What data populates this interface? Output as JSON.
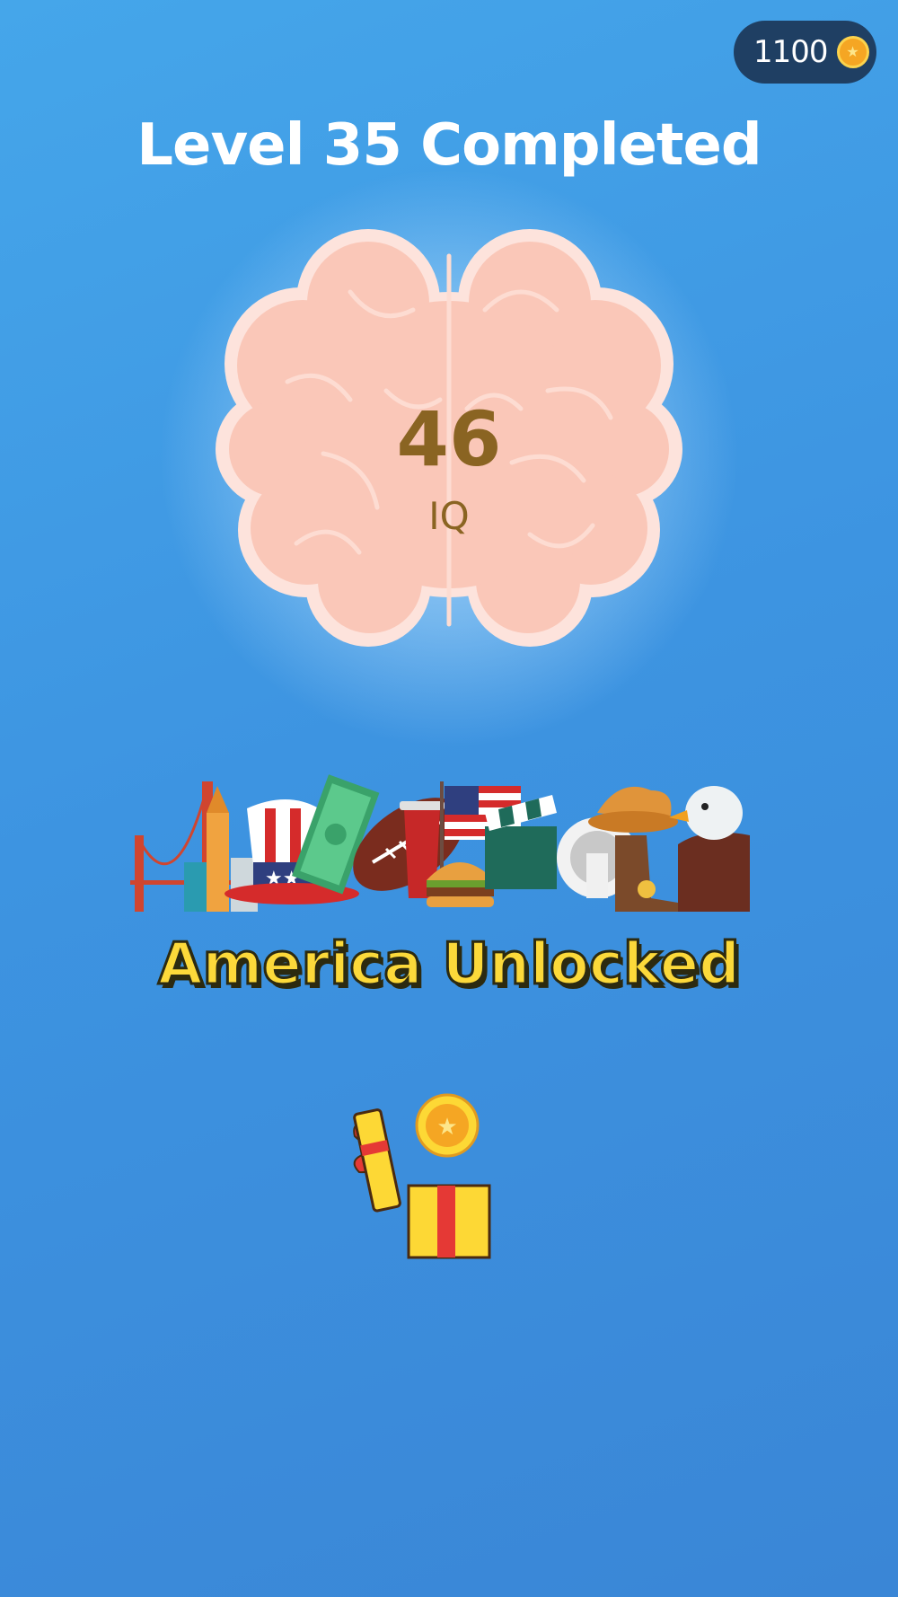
{
  "header": {
    "coins": "1100",
    "coin_icon": "coin-icon"
  },
  "level": {
    "title": "Level 35 Completed"
  },
  "result": {
    "iq_value": "46",
    "iq_label": "IQ"
  },
  "unlock": {
    "banner_icons": [
      "golden-gate-bridge-icon",
      "skyscraper-icon",
      "uncle-sam-hat-icon",
      "dollar-bills-icon",
      "american-football-icon",
      "soda-cup-icon",
      "american-flag-icon",
      "burger-icon",
      "clapperboard-icon",
      "headdress-icon",
      "cowboy-hat-icon",
      "cowboy-boot-icon",
      "eagle-icon"
    ],
    "text": "America Unlocked"
  },
  "reward": {
    "icon": "gift-box-icon"
  },
  "colors": {
    "background": "#3d94e1",
    "coin_pill": "#1f3f63",
    "brain": "#fac7b8",
    "iq_text": "#8a6422",
    "unlocked_text": "#fcd93a"
  }
}
